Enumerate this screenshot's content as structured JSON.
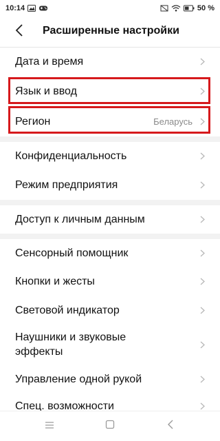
{
  "status_bar": {
    "time": "10:14",
    "battery": "50 %",
    "left_icons": [
      "image-icon",
      "gamepad-icon"
    ],
    "right_icons": [
      "notification-icon",
      "wifi-icon",
      "battery-icon"
    ]
  },
  "header": {
    "title": "Расширенные настройки",
    "back_icon": "back-arrow-icon"
  },
  "rows": [
    {
      "label": "Дата и время",
      "value": ""
    },
    {
      "label": "Язык и ввод",
      "value": ""
    },
    {
      "label": "Регион",
      "value": "Беларусь"
    },
    {
      "label": "Конфиденциальность",
      "value": ""
    },
    {
      "label": "Режим предприятия",
      "value": ""
    },
    {
      "label": "Доступ к личным данным",
      "value": ""
    },
    {
      "label": "Сенсорный помощник",
      "value": ""
    },
    {
      "label": "Кнопки и жесты",
      "value": ""
    },
    {
      "label": "Световой индикатор",
      "value": ""
    },
    {
      "label": "Наушники и звуковые эффекты",
      "value": ""
    },
    {
      "label": "Управление одной рукой",
      "value": ""
    },
    {
      "label": "Спец. возможности",
      "value": ""
    }
  ],
  "nav_bar": {
    "icons": [
      "menu-icon",
      "home-icon",
      "back-icon"
    ]
  },
  "colors": {
    "highlight": "#d6191c",
    "separator": "#f2f2f2",
    "chevron": "#b8b8b8"
  }
}
